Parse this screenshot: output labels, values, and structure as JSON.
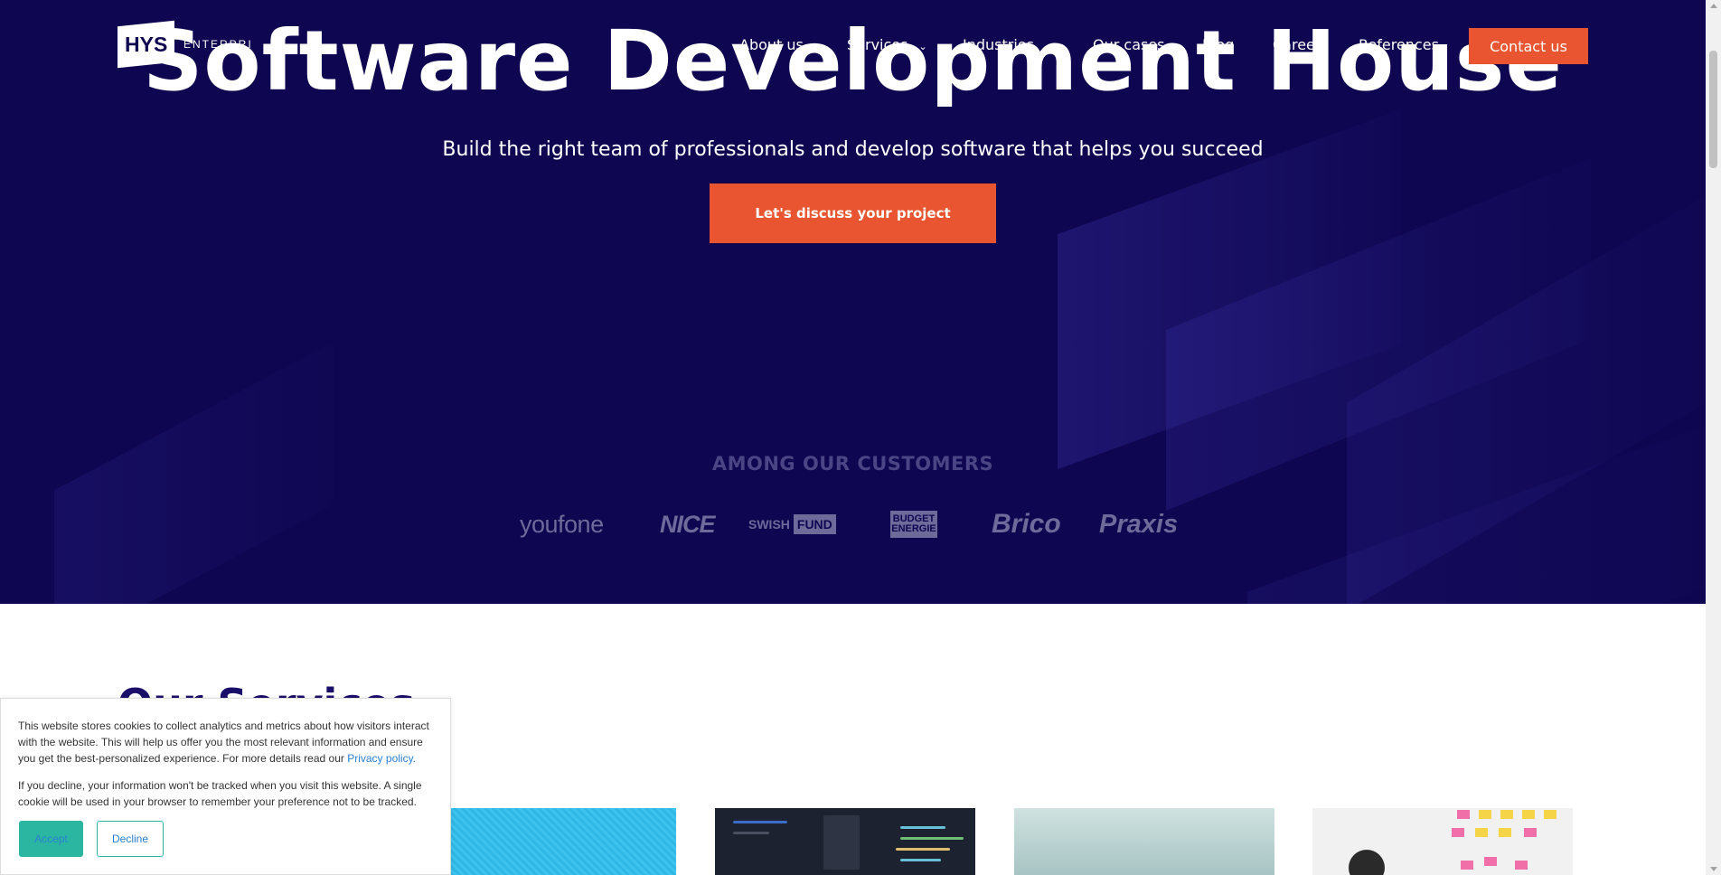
{
  "brand": {
    "logo_mark": "HYS",
    "logo_text": "ENTERPRI"
  },
  "nav": {
    "items": [
      {
        "label": "About us",
        "has_dropdown": false
      },
      {
        "label": "Services",
        "has_dropdown": true
      },
      {
        "label": "Industries",
        "has_dropdown": true
      },
      {
        "label": "Our cases",
        "has_dropdown": false
      },
      {
        "label": "Blog",
        "has_dropdown": false
      },
      {
        "label": "Career",
        "has_dropdown": false
      },
      {
        "label": "References",
        "has_dropdown": false
      }
    ],
    "contact_label": "Contact us"
  },
  "hero": {
    "title": "Software Development House",
    "subtitle": "Build the right team of professionals and develop software that helps you succeed",
    "cta_label": "Let's discuss your project"
  },
  "customers": {
    "title": "AMONG OUR CUSTOMERS",
    "logos": [
      "youfone",
      "NICE",
      "SWISH",
      "FUND",
      "BUDGET",
      "ENERGIE",
      "Brico",
      "Praxis"
    ]
  },
  "services": {
    "heading": "Our Services"
  },
  "cookie": {
    "text1": "This website stores cookies to collect analytics and metrics about how visitors interact with the website. This will help us offer you the most relevant information and ensure you get the best-personalized experience. For more details read our",
    "privacy_link": "Privacy policy.",
    "text2": "If you decline, your information won't be tracked when you visit this website. A single cookie will be used in your browser to remember your preference not to be tracked.",
    "accept_label": "Accept",
    "decline_label": "Decline"
  },
  "colors": {
    "hero_bg": "#0e0650",
    "accent": "#e95530",
    "cookie_accent": "#2bb6a1",
    "heading": "#1a0e6b"
  }
}
